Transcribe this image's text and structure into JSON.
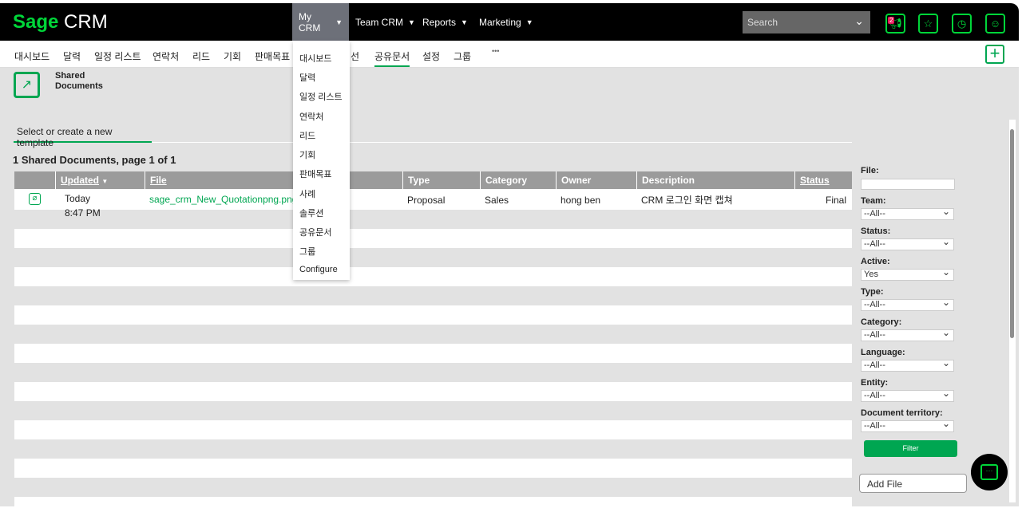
{
  "app": {
    "logo_brand": "Sage",
    "logo_product": "CRM"
  },
  "topnav": [
    {
      "label": "My CRM"
    },
    {
      "label": "Team CRM"
    },
    {
      "label": "Reports"
    },
    {
      "label": "Marketing"
    }
  ],
  "search": {
    "placeholder": "Search"
  },
  "notifications": {
    "count": "2"
  },
  "subnav": [
    "대시보드",
    "달력",
    "일정 리스트",
    "연락처",
    "리드",
    "기회",
    "판매목표",
    "선",
    "공유문서",
    "설정",
    "그룹",
    "•••"
  ],
  "dropdown": [
    "대시보드",
    "달력",
    "일정 리스트",
    "연락처",
    "리드",
    "기회",
    "판매목표",
    "사례",
    "솔루션",
    "공유문서",
    "그룹",
    "Configure"
  ],
  "page": {
    "title_line1": "Shared",
    "title_line2": "Documents",
    "tab": "Select or create a new template",
    "count_text": "1 Shared Documents, page 1 of 1"
  },
  "table": {
    "columns": [
      "",
      "Updated",
      "File",
      "Type",
      "Category",
      "Owner",
      "Description",
      "Status"
    ],
    "rows": [
      {
        "updated_day": "Today",
        "updated_time": "8:47 PM",
        "file": "sage_crm_New_Quotationpng.png",
        "type": "Proposal",
        "category": "Sales",
        "owner": "hong ben",
        "description": "CRM 로그인 화면 캡쳐",
        "status": "Final"
      }
    ]
  },
  "filters": {
    "file_label": "File:",
    "team_label": "Team:",
    "team": "--All--",
    "status_label": "Status:",
    "status": "--All--",
    "active_label": "Active:",
    "active": "Yes",
    "type_label": "Type:",
    "type": "--All--",
    "category_label": "Category:",
    "category": "--All--",
    "language_label": "Language:",
    "language": "--All--",
    "entity_label": "Entity:",
    "entity": "--All--",
    "territory_label": "Document territory:",
    "territory": "--All--",
    "filter_button": "Filter",
    "add_file": "Add File"
  },
  "colors": {
    "accent": "#00a651",
    "brand": "#00d639"
  }
}
